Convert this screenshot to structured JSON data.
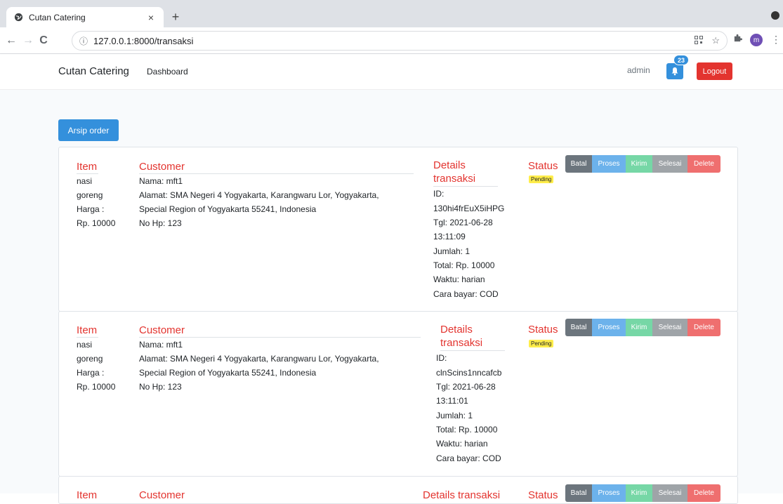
{
  "browser": {
    "tab_title": "Cutan Catering",
    "tab_close": "×",
    "new_tab": "+",
    "url": "127.0.0.1:8000/transaksi",
    "back": "←",
    "forward": "→",
    "reload": "C",
    "info": "ⓘ",
    "profile_initial": "m"
  },
  "navbar": {
    "brand": "Cutan Catering",
    "dashboard": "Dashboard",
    "user": "admin",
    "notif_count": "23",
    "logout": "Logout"
  },
  "arsip_button": "Arsip order",
  "labels": {
    "item": "Item",
    "customer": "Customer",
    "details": "Details",
    "transaksi": "transaksi",
    "details_full": "Details transaksi",
    "status": "Status",
    "pending": "Pending",
    "batal": "Batal",
    "proses": "Proses",
    "kirim": "Kirim",
    "selesai": "Selesai",
    "delete": "Delete"
  },
  "orders": [
    {
      "item_name_1": "nasi",
      "item_name_2": "goreng",
      "harga_label": "Harga :",
      "harga_value": "Rp. 10000",
      "nama": "Nama: mft1",
      "alamat_1": "Alamat: SMA Negeri 4 Yogyakarta, Karangwaru Lor, Yogyakarta,",
      "alamat_2": "Special Region of Yogyakarta 55241, Indonesia",
      "nohp": "No Hp: 123",
      "id_label": "ID:",
      "id_value": "130hi4frEuX5iHPG",
      "tgl_1": "Tgl: 2021-06-28",
      "tgl_2": "13:11:09",
      "jumlah": "Jumlah: 1",
      "total": "Total: Rp. 10000",
      "waktu": "Waktu: harian",
      "cara": "Cara bayar: COD"
    },
    {
      "item_name_1": "nasi",
      "item_name_2": "goreng",
      "harga_label": "Harga :",
      "harga_value": "Rp. 10000",
      "nama": "Nama: mft1",
      "alamat_1": "Alamat: SMA Negeri 4 Yogyakarta, Karangwaru Lor, Yogyakarta,",
      "alamat_2": "Special Region of Yogyakarta 55241, Indonesia",
      "nohp": "No Hp: 123",
      "id_label": "ID:",
      "id_value": "clnScins1nncafcb",
      "tgl_1": "Tgl: 2021-06-28",
      "tgl_2": "13:11:01",
      "jumlah": "Jumlah: 1",
      "total": "Total: Rp. 10000",
      "waktu": "Waktu: harian",
      "cara": "Cara bayar: COD"
    }
  ],
  "colors": {
    "primary": "#3490dc",
    "danger": "#e3342f",
    "pending": "#ffed4a"
  }
}
